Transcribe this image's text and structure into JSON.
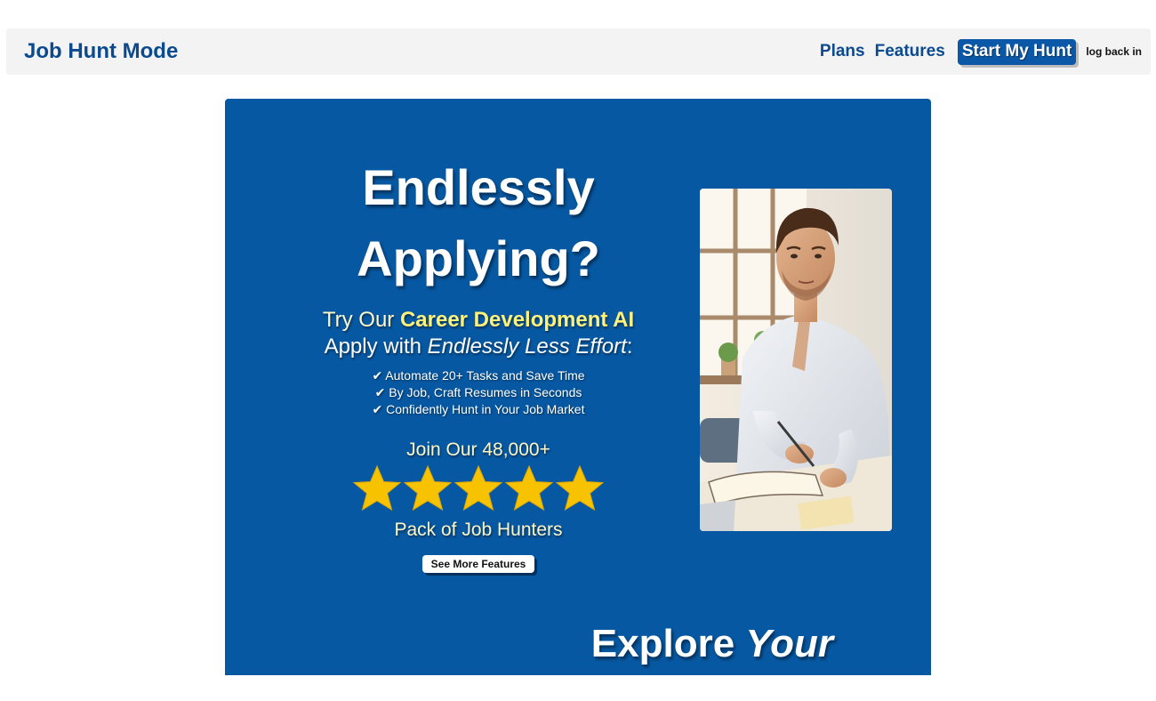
{
  "header": {
    "brand": "Job Hunt Mode",
    "nav": {
      "plans": "Plans",
      "features": "Features",
      "cta": "Start My Hunt",
      "login": "log back in"
    }
  },
  "hero": {
    "headline_line1": "Endlessly",
    "headline_line2": "Applying?",
    "sub_prefix": "Try Our ",
    "sub_highlight": "Career Development AI",
    "sub2_prefix": "Apply with ",
    "sub2_emphasis": "Endlessly Less Effort",
    "sub2_suffix": ":",
    "bullets": [
      "✔ Automate 20+ Tasks and Save Time",
      "✔ By Job, Craft Resumes in Seconds",
      "✔ Confidently Hunt in Your Job Market"
    ],
    "join_text": "Join Our 48,000+",
    "rating": 5,
    "pack_text": "Pack of Job Hunters",
    "more_button": "See More Features",
    "explore_prefix": "Explore ",
    "explore_emphasis": "Your"
  },
  "colors": {
    "brand_blue": "#0b4a8f",
    "hero_bg": "#0758a2",
    "star_gold": "#f7c200",
    "highlight_yellow": "#fff27a"
  },
  "icons": {
    "rating": "star-icon",
    "bullet": "check-mark"
  }
}
